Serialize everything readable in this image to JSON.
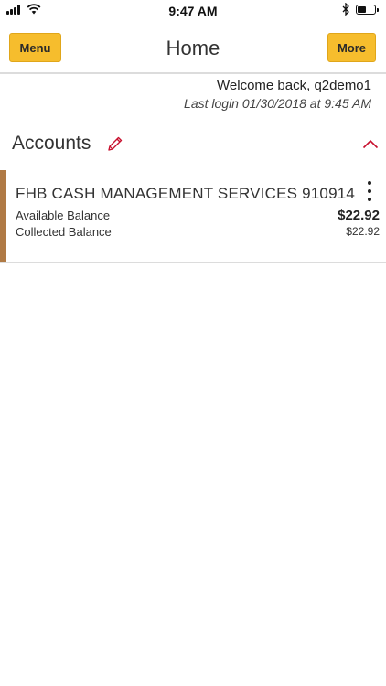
{
  "status_bar": {
    "time": "9:47 AM",
    "icons": [
      "signal-icon",
      "wifi-icon",
      "bluetooth-icon",
      "battery-icon"
    ]
  },
  "header": {
    "menu_label": "Menu",
    "title": "Home",
    "more_label": "More"
  },
  "welcome": {
    "greeting": "Welcome back, q2demo1",
    "last_login": "Last login 01/30/2018 at 9:45 AM"
  },
  "accounts": {
    "title": "Accounts",
    "items": [
      {
        "name": "FHB CASH MANAGEMENT SERVICES 910914",
        "available_label": "Available Balance",
        "available_value": "$22.92",
        "collected_label": "Collected Balance",
        "collected_value": "$22.92"
      }
    ]
  },
  "colors": {
    "button_bg": "#f6bd2d",
    "accent_bar": "#b07a45",
    "collapse_chevron": "#c8102e",
    "edit_pencil": "#c8102e"
  }
}
